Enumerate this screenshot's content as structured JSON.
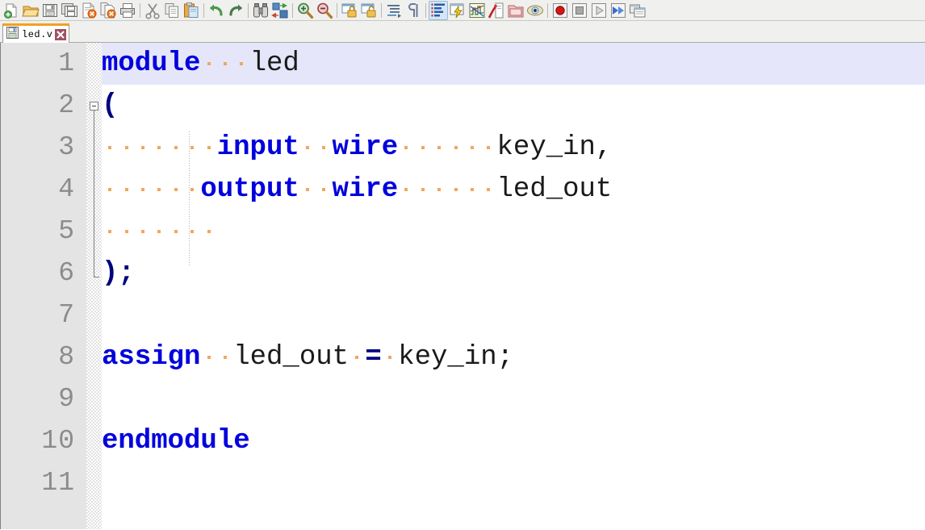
{
  "window": {
    "title": "led.v",
    "colors": {
      "keyword": "#0000dd",
      "operator": "#000080",
      "identifier": "#1a1a1a",
      "current_line_highlight": "#e6e6fa",
      "gutter_bg": "#e4e4e4",
      "line_number": "#8c8c8c",
      "space_dot": "#f0a860",
      "tab_active_border": "#f2a11e",
      "toolbar_bg": "#f0f0ee"
    }
  },
  "toolbar": {
    "items": [
      {
        "name": "new-file-icon",
        "label": "New"
      },
      {
        "name": "open-folder-icon",
        "label": "Open"
      },
      {
        "name": "save-icon",
        "label": "Save"
      },
      {
        "name": "save-all-icon",
        "label": "Save All"
      },
      {
        "name": "close-file-icon",
        "label": "Close"
      },
      {
        "name": "close-all-files-icon",
        "label": "Close All"
      },
      {
        "name": "print-icon",
        "label": "Print"
      },
      {
        "name": "separator",
        "label": ""
      },
      {
        "name": "cut-scissors-icon",
        "label": "Cut"
      },
      {
        "name": "copy-icon",
        "label": "Copy"
      },
      {
        "name": "paste-icon",
        "label": "Paste"
      },
      {
        "name": "separator",
        "label": ""
      },
      {
        "name": "undo-icon",
        "label": "Undo"
      },
      {
        "name": "redo-icon",
        "label": "Redo"
      },
      {
        "name": "separator",
        "label": ""
      },
      {
        "name": "find-binoculars-icon",
        "label": "Find"
      },
      {
        "name": "replace-icon",
        "label": "Replace"
      },
      {
        "name": "separator",
        "label": ""
      },
      {
        "name": "zoom-in-icon",
        "label": "Zoom In"
      },
      {
        "name": "zoom-out-icon",
        "label": "Zoom Out"
      },
      {
        "name": "separator",
        "label": ""
      },
      {
        "name": "lock-window-icon",
        "label": "Lock Window"
      },
      {
        "name": "unlock-window-icon",
        "label": "Unlock Window"
      },
      {
        "name": "separator",
        "label": ""
      },
      {
        "name": "indent-guides-icon",
        "label": "Indent Guides"
      },
      {
        "name": "paragraph-marks-icon",
        "label": "Show Formatting"
      },
      {
        "name": "separator",
        "label": ""
      },
      {
        "name": "outline-list-icon",
        "label": "Outline"
      },
      {
        "name": "compile-flash-icon",
        "label": "Compile"
      },
      {
        "name": "waveform-icon",
        "label": "Waveform"
      },
      {
        "name": "wand-icon",
        "label": "Templates"
      },
      {
        "name": "project-folder-icon",
        "label": "Project"
      },
      {
        "name": "watch-eye-icon",
        "label": "Watch"
      },
      {
        "name": "separator",
        "label": ""
      },
      {
        "name": "record-icon",
        "label": "Record Macro"
      },
      {
        "name": "stop-icon",
        "label": "Stop Macro"
      },
      {
        "name": "play-icon",
        "label": "Play Macro"
      },
      {
        "name": "fast-forward-icon",
        "label": "Run Fast"
      },
      {
        "name": "window-list-icon",
        "label": "Windows"
      }
    ]
  },
  "tabs": [
    {
      "label": "led.v",
      "icon": "floppy-disk-icon",
      "close": "close-tab-icon",
      "active": true
    }
  ],
  "editor": {
    "gutter_width": 106,
    "fold_column_width": 19,
    "line_height": 52,
    "lines": [
      {
        "num": "1",
        "highlight": true,
        "tokens": [
          {
            "t": "module",
            "k": "kw"
          },
          {
            "t": "   ",
            "k": "sp"
          },
          {
            "t": "led",
            "k": "id"
          }
        ]
      },
      {
        "num": "2",
        "highlight": false,
        "fold": "open",
        "tokens": [
          {
            "t": "(",
            "k": "op"
          }
        ]
      },
      {
        "num": "3",
        "highlight": false,
        "tokens": [
          {
            "t": "       ",
            "k": "sp"
          },
          {
            "t": "input",
            "k": "kw"
          },
          {
            "t": "  ",
            "k": "sp"
          },
          {
            "t": "wire",
            "k": "kw"
          },
          {
            "t": "      ",
            "k": "sp"
          },
          {
            "t": "key_in,",
            "k": "id"
          }
        ]
      },
      {
        "num": "4",
        "highlight": false,
        "tokens": [
          {
            "t": "      ",
            "k": "sp"
          },
          {
            "t": "output",
            "k": "kw"
          },
          {
            "t": "  ",
            "k": "sp"
          },
          {
            "t": "wire",
            "k": "kw"
          },
          {
            "t": "      ",
            "k": "sp"
          },
          {
            "t": "led_out",
            "k": "id"
          }
        ]
      },
      {
        "num": "5",
        "highlight": false,
        "tokens": [
          {
            "t": "       ",
            "k": "sp"
          }
        ]
      },
      {
        "num": "6",
        "highlight": false,
        "foldend": true,
        "tokens": [
          {
            "t": ");",
            "k": "op"
          }
        ]
      },
      {
        "num": "7",
        "highlight": false,
        "tokens": []
      },
      {
        "num": "8",
        "highlight": false,
        "tokens": [
          {
            "t": "assign",
            "k": "kw"
          },
          {
            "t": "  ",
            "k": "sp"
          },
          {
            "t": "led_out",
            "k": "id"
          },
          {
            "t": " ",
            "k": "sp"
          },
          {
            "t": "=",
            "k": "op"
          },
          {
            "t": " ",
            "k": "sp"
          },
          {
            "t": "key_in;",
            "k": "id"
          }
        ]
      },
      {
        "num": "9",
        "highlight": false,
        "tokens": []
      },
      {
        "num": "10",
        "highlight": false,
        "tokens": [
          {
            "t": "endmodule",
            "k": "kw"
          }
        ]
      },
      {
        "num": "11",
        "highlight": false,
        "tokens": []
      }
    ]
  }
}
